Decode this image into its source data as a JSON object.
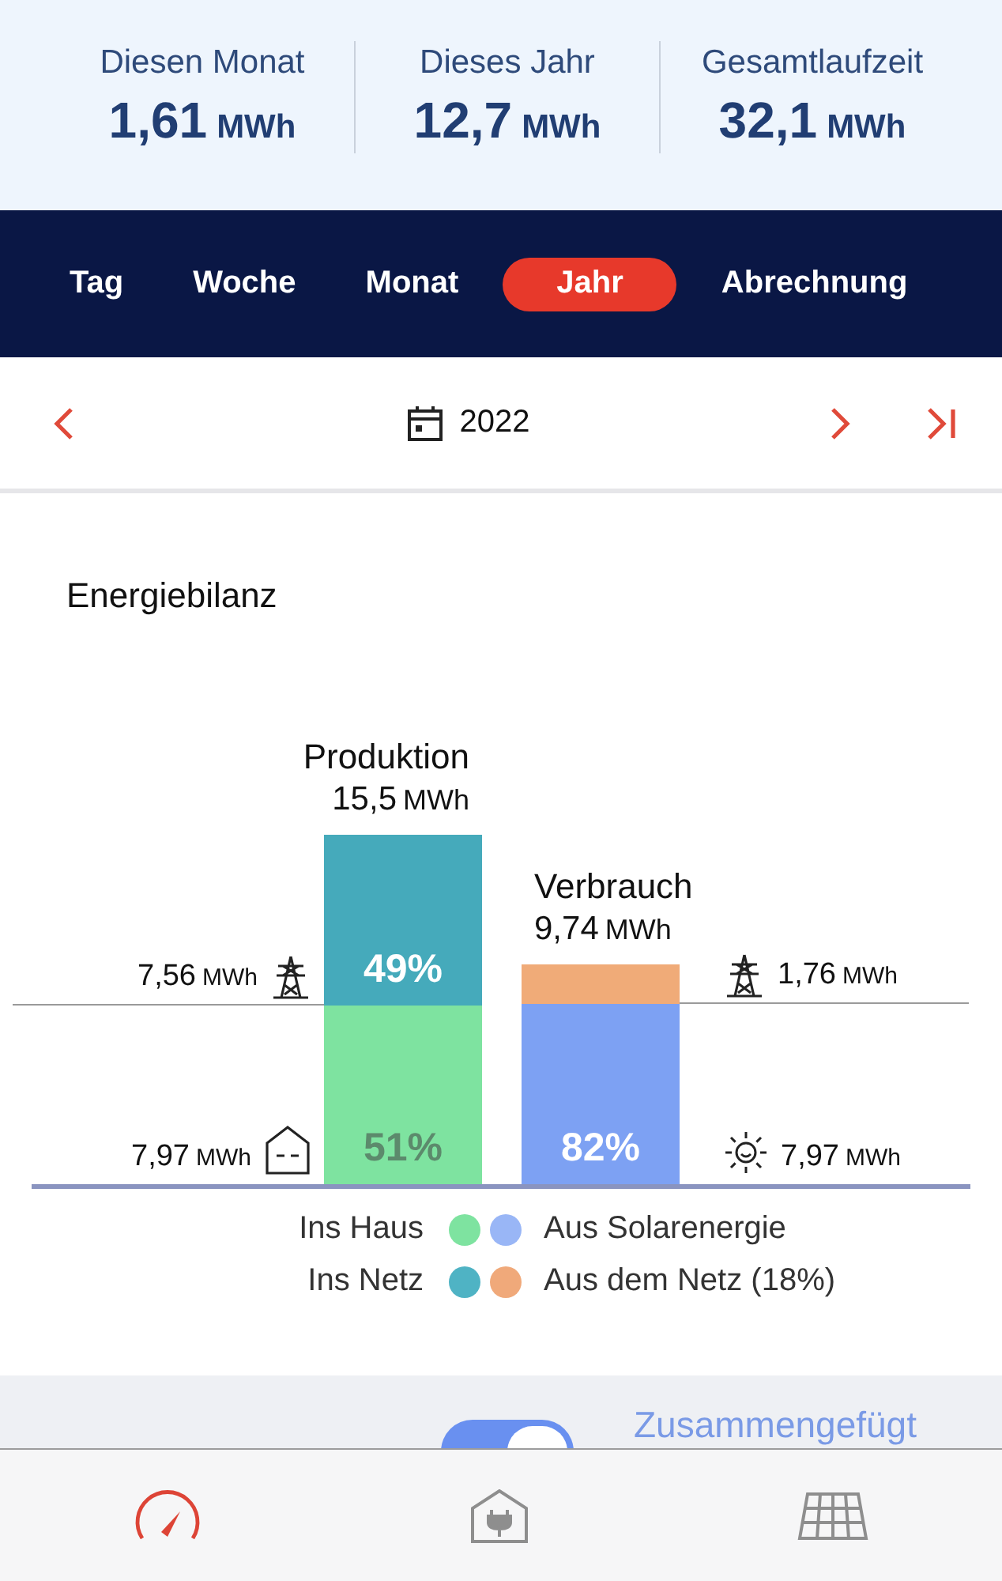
{
  "stats": [
    {
      "label": "Diesen Monat",
      "value": "1,61",
      "unit": "MWh"
    },
    {
      "label": "Dieses Jahr",
      "value": "12,7",
      "unit": "MWh"
    },
    {
      "label": "Gesamtlaufzeit",
      "value": "32,1",
      "unit": "MWh"
    }
  ],
  "tabs": [
    {
      "label": "Tag",
      "selected": false
    },
    {
      "label": "Woche",
      "selected": false
    },
    {
      "label": "Monat",
      "selected": false
    },
    {
      "label": "Jahr",
      "selected": true
    },
    {
      "label": "Abrechnung",
      "selected": false
    }
  ],
  "date_nav": {
    "period": "2022"
  },
  "energy_balance": {
    "title": "Energiebilanz",
    "bars": [
      {
        "title": "Produktion",
        "value": "15,5",
        "unit": "MWh",
        "segments": [
          {
            "percent": "49%",
            "color": "#45aabb",
            "side_value": "7,56",
            "side_unit": "MWh"
          },
          {
            "percent": "51%",
            "color": "#7ee3a0",
            "side_value": "7,97",
            "side_unit": "MWh"
          }
        ]
      },
      {
        "title": "Verbrauch",
        "value": "9,74",
        "unit": "MWh",
        "segments": [
          {
            "color": "#f0ab78",
            "side_value": "1,76",
            "side_unit": "MWh"
          },
          {
            "percent": "82%",
            "color": "#7da1f3",
            "side_value": "7,97",
            "side_unit": "MWh"
          }
        ]
      }
    ],
    "legend_production": [
      {
        "label": "Ins Haus",
        "color": "#7ee3a0"
      },
      {
        "label": "Ins Netz",
        "color": "#4fb3c4"
      }
    ],
    "legend_consumption": [
      {
        "label": "Aus Solarenergie",
        "color": "#99b6f6"
      },
      {
        "label": "Aus dem Netz (18%)",
        "color": "#f0a97a"
      }
    ]
  },
  "merged_toggle": {
    "on": true,
    "link": "Zusammengefügt"
  },
  "bottom_tabs": [
    {
      "selected": true
    },
    {
      "selected": false
    },
    {
      "selected": false
    }
  ]
}
